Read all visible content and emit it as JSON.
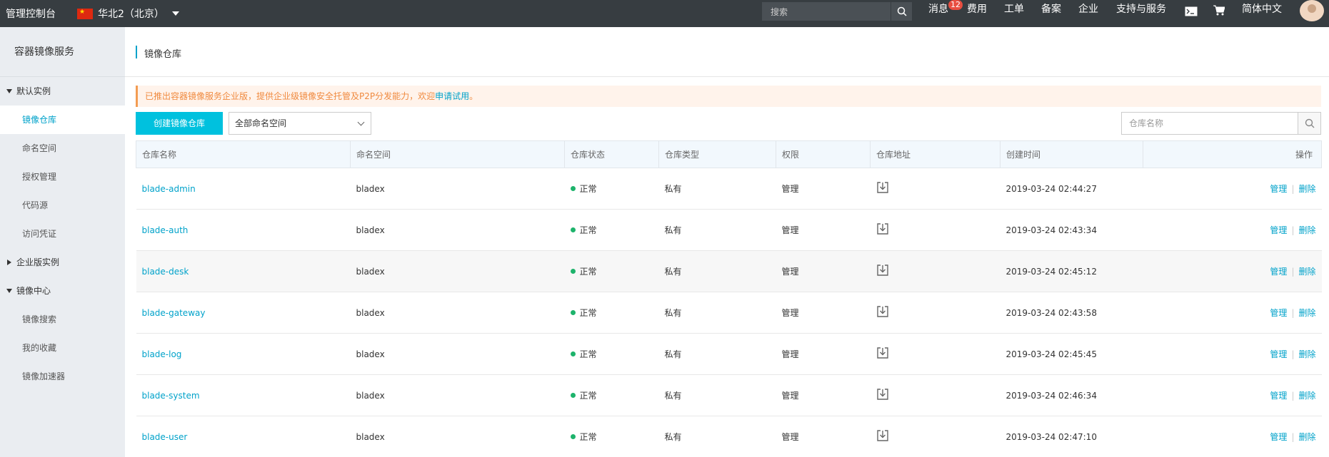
{
  "topbar": {
    "brand": "管理控制台",
    "region": "华北2（北京）",
    "search_placeholder": "搜索",
    "nav": {
      "messages": "消息",
      "messages_badge": "12",
      "billing": "费用",
      "tickets": "工单",
      "icp": "备案",
      "enterprise": "企业",
      "support": "支持与服务",
      "language": "简体中文"
    }
  },
  "sidebar": {
    "title": "容器镜像服务",
    "groups": [
      {
        "label": "默认实例",
        "expanded": true,
        "items": [
          "镜像仓库",
          "命名空间",
          "授权管理",
          "代码源",
          "访问凭证"
        ]
      },
      {
        "label": "企业版实例",
        "expanded": false,
        "items": []
      },
      {
        "label": "镜像中心",
        "expanded": true,
        "items": [
          "镜像搜索",
          "我的收藏",
          "镜像加速器"
        ]
      }
    ],
    "active_item": "镜像仓库"
  },
  "main": {
    "title": "镜像仓库",
    "notice": {
      "text": "已推出容器镜像服务企业版，提供企业级镜像安全托管及P2P分发能力，欢迎",
      "link": "申请试用",
      "end": "。"
    },
    "create_button": "创建镜像仓库",
    "namespace_select": "全部命名空间",
    "search_placeholder": "仓库名称",
    "table": {
      "columns": [
        "仓库名称",
        "命名空间",
        "仓库状态",
        "仓库类型",
        "权限",
        "仓库地址",
        "创建时间",
        "操作"
      ],
      "rows": [
        {
          "name": "blade-admin",
          "namespace": "bladex",
          "status": "正常",
          "type": "私有",
          "permission": "管理",
          "created": "2019-03-24 02:44:27"
        },
        {
          "name": "blade-auth",
          "namespace": "bladex",
          "status": "正常",
          "type": "私有",
          "permission": "管理",
          "created": "2019-03-24 02:43:34"
        },
        {
          "name": "blade-desk",
          "namespace": "bladex",
          "status": "正常",
          "type": "私有",
          "permission": "管理",
          "created": "2019-03-24 02:45:12"
        },
        {
          "name": "blade-gateway",
          "namespace": "bladex",
          "status": "正常",
          "type": "私有",
          "permission": "管理",
          "created": "2019-03-24 02:43:58"
        },
        {
          "name": "blade-log",
          "namespace": "bladex",
          "status": "正常",
          "type": "私有",
          "permission": "管理",
          "created": "2019-03-24 02:45:45"
        },
        {
          "name": "blade-system",
          "namespace": "bladex",
          "status": "正常",
          "type": "私有",
          "permission": "管理",
          "created": "2019-03-24 02:46:34"
        },
        {
          "name": "blade-user",
          "namespace": "bladex",
          "status": "正常",
          "type": "私有",
          "permission": "管理",
          "created": "2019-03-24 02:47:10"
        }
      ],
      "op_manage": "管理",
      "op_delete": "删除",
      "op_separator": "|"
    }
  },
  "colors": {
    "topbar": "#373d41",
    "accent": "#00a2ca",
    "button": "#00c1de",
    "status_ok": "#1db36b",
    "notice_text": "#f08a3f"
  }
}
